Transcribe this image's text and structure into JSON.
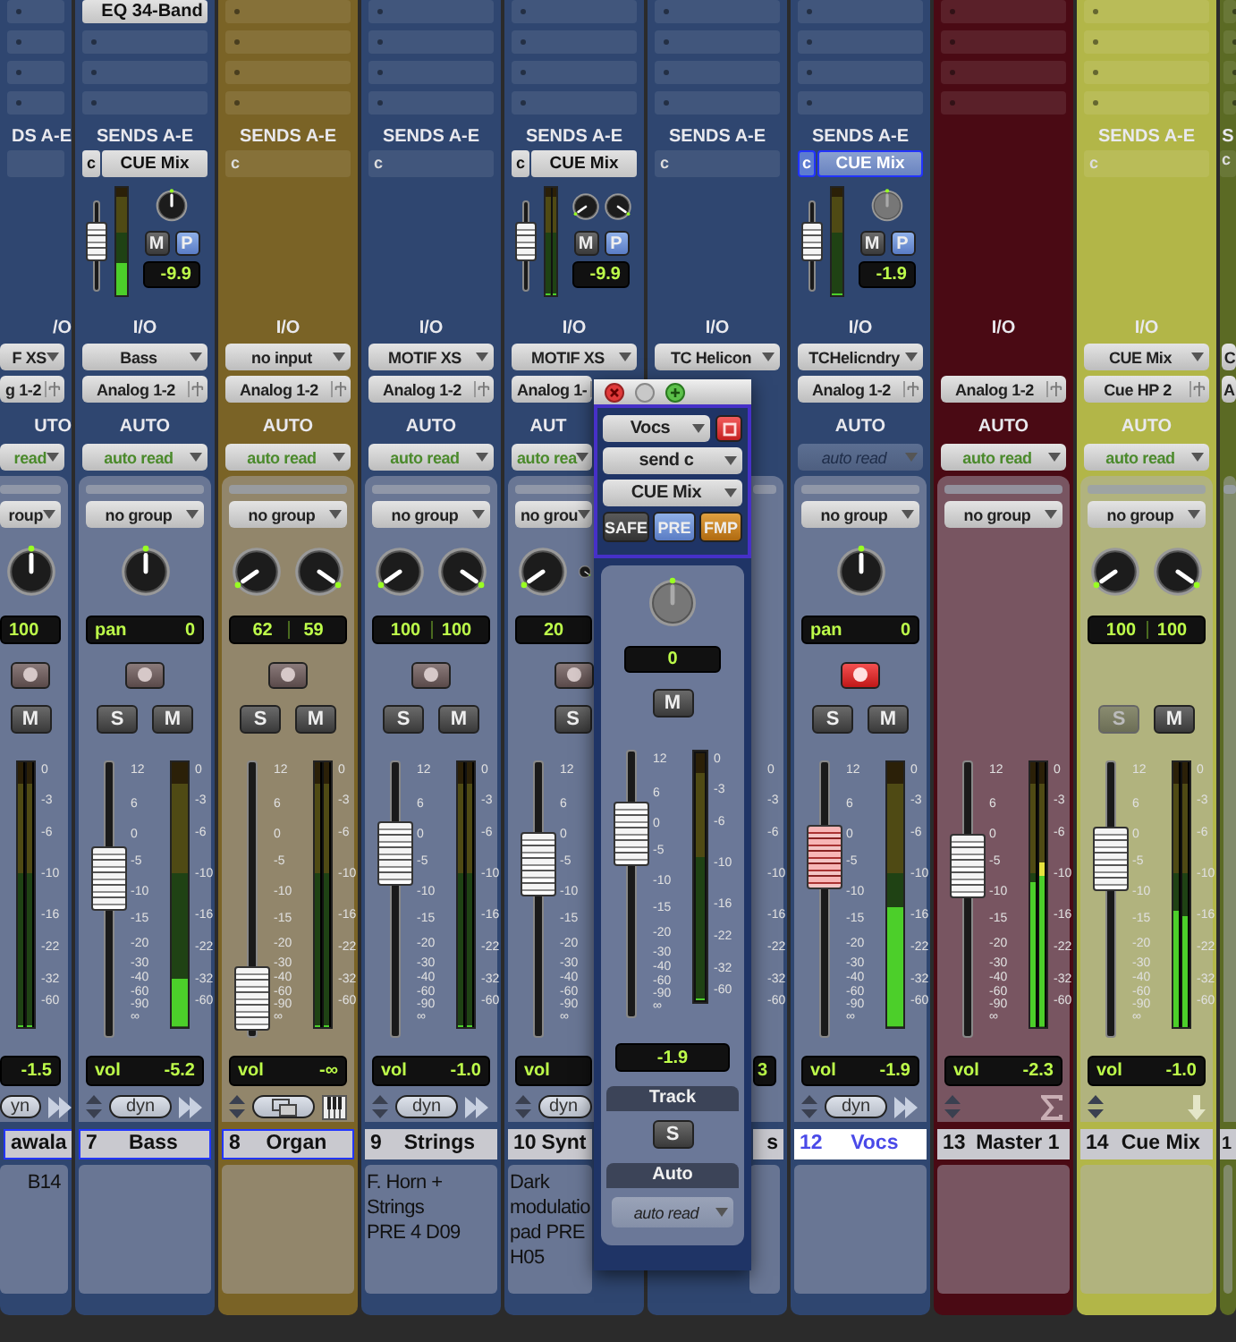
{
  "strips": [
    {
      "kind": "audio",
      "color": "#2f4670",
      "sends_header": "DS A-E",
      "io_label": "/O",
      "input": "F XS",
      "output": "g 1-2",
      "auto_label": "UTO",
      "automation": "read",
      "automation_disabled": false,
      "group": "roup",
      "stereo": false,
      "pan_readouts": [
        "100"
      ],
      "rec_armed": false,
      "mute": {
        "label": "M"
      },
      "meters": [
        {
          "level": 0
        },
        {
          "level": 0
        }
      ],
      "meter_scale": [
        "0",
        "-3",
        "-6",
        "-10",
        "-16",
        "-22",
        "-32",
        "-60"
      ],
      "vol_value": "-1.5",
      "dyn_label": "yn",
      "name": "awala",
      "selected": true,
      "highlighted": false,
      "comments": "B14"
    },
    {
      "kind": "audio",
      "color": "#2f4670",
      "inserts": [
        "EQ 34-Band"
      ],
      "sends_header": "SENDS A-E",
      "send": {
        "slot": "c",
        "name": "CUE Mix",
        "selected": false,
        "level": 0.6,
        "meters": [
          {
            "level": 0.3
          }
        ],
        "stereo": false,
        "mute_label": "M",
        "pre": {
          "label": "P",
          "on": true
        },
        "value": "-9.9"
      },
      "io_label": "I/O",
      "input": "Bass",
      "output": "Analog 1-2",
      "auto_label": "AUTO",
      "automation": "auto read",
      "automation_disabled": false,
      "group": "no group",
      "stereo": false,
      "pan_readouts": [
        "pan",
        "0"
      ],
      "rec_armed": false,
      "solo": {
        "label": "S",
        "disabled": false
      },
      "mute": {
        "label": "M"
      },
      "fader": {
        "level": 0.6
      },
      "fader_scale": [
        "12",
        "6",
        "0",
        "-5",
        "-10",
        "-15",
        "-20",
        "-30",
        "-40",
        "-60",
        "-90",
        "∞"
      ],
      "meters": [
        {
          "level": 0.18
        }
      ],
      "meter_scale": [
        "0",
        "-3",
        "-6",
        "-10",
        "-16",
        "-22",
        "-32",
        "-60"
      ],
      "vol_label": "vol",
      "vol_value": "-5.2",
      "dyn_label": "dyn",
      "number": "7",
      "name": "Bass",
      "selected": true,
      "highlighted": false
    },
    {
      "kind": "instrument",
      "color": "#7a6326",
      "sends_header": "SENDS A-E",
      "send": {
        "slot": "c"
      },
      "io_label": "I/O",
      "input": "no input",
      "output": "Analog 1-2",
      "auto_label": "AUTO",
      "automation": "auto read",
      "automation_disabled": false,
      "group": "no group",
      "stereo": true,
      "pan_readouts": [
        "62",
        "59"
      ],
      "rec_armed": false,
      "solo": {
        "label": "S",
        "disabled": false
      },
      "mute": {
        "label": "M"
      },
      "fader": {
        "level": 0.03
      },
      "fader_scale": [
        "12",
        "6",
        "0",
        "-5",
        "-10",
        "-15",
        "-20",
        "-30",
        "-40",
        "-60",
        "-90",
        "∞"
      ],
      "meters": [
        {
          "level": 0
        },
        {
          "level": 0
        }
      ],
      "meter_scale": [
        "0",
        "-3",
        "-6",
        "-10",
        "-16",
        "-22",
        "-32",
        "-60"
      ],
      "vol_label": "vol",
      "vol_value": "-∞",
      "number": "8",
      "name": "Organ",
      "selected": true,
      "highlighted": false
    },
    {
      "kind": "audio",
      "color": "#2f4670",
      "sends_header": "SENDS A-E",
      "send": {
        "slot": "c"
      },
      "io_label": "I/O",
      "input": "MOTIF XS",
      "output": "Analog 1-2",
      "auto_label": "AUTO",
      "automation": "auto read",
      "automation_disabled": false,
      "group": "no group",
      "stereo": true,
      "pan_readouts": [
        "100",
        "100"
      ],
      "rec_armed": false,
      "solo": {
        "label": "S",
        "disabled": false
      },
      "mute": {
        "label": "M"
      },
      "fader": {
        "level": 0.72
      },
      "fader_scale": [
        "12",
        "6",
        "0",
        "-5",
        "-10",
        "-15",
        "-20",
        "-30",
        "-40",
        "-60",
        "-90",
        "∞"
      ],
      "meters": [
        {
          "level": 0
        },
        {
          "level": 0
        }
      ],
      "meter_scale": [
        "0",
        "-3",
        "-6",
        "-10",
        "-16",
        "-22",
        "-32",
        "-60"
      ],
      "vol_label": "vol",
      "vol_value": "-1.0",
      "dyn_label": "dyn",
      "number": "9",
      "name": "Strings",
      "selected": false,
      "highlighted": false,
      "comments": "F. Horn +\nStrings\nPRE 4 D09"
    },
    {
      "kind": "audio",
      "color": "#2f4670",
      "sends_header": "SENDS A-E",
      "send": {
        "slot": "c",
        "name": "CUE Mix",
        "selected": false,
        "level": 0.6,
        "meters": [
          {
            "level": 0
          },
          {
            "level": 0
          }
        ],
        "stereo": true,
        "mute_label": "M",
        "pre": {
          "label": "P",
          "on": true
        },
        "value": "-9.9"
      },
      "io_label": "I/O",
      "input": "MOTIF XS",
      "output": "Analog 1-",
      "auto_label": "AUT",
      "automation": "auto rea",
      "automation_disabled": false,
      "group": "no grou",
      "stereo": true,
      "pan_readouts": [
        "20"
      ],
      "rec_armed": false,
      "solo": {
        "label": "S",
        "disabled": false
      },
      "fader": {
        "level": 0.67
      },
      "fader_scale": [
        "12",
        "6",
        "0",
        "-5",
        "-10",
        "-15",
        "-20",
        "-30",
        "-40",
        "-60",
        "-90",
        "∞"
      ],
      "vol_label": "vol",
      "dyn_label": "dyn",
      "number": "10",
      "name": "Synt",
      "selected": false,
      "highlighted": false,
      "comments": "Dark\nmodulatio\npad PRE\nH05"
    },
    {
      "kind": "audio",
      "color": "#2f4670",
      "sends_header": "SENDS A-E",
      "send": {
        "slot": "c"
      },
      "io_label": "I/O",
      "input": "TC Helicon",
      "meter_scale": [
        "0",
        "-3",
        "-6",
        "-10",
        "-16",
        "-22",
        "-32",
        "-60"
      ],
      "vol_value": "3",
      "name": "s",
      "selected": false,
      "highlighted": false
    },
    {
      "kind": "audio",
      "color": "#2f4670",
      "sends_header": "SENDS A-E",
      "send": {
        "slot": "c",
        "name": "CUE Mix",
        "selected": true,
        "level": 0.6,
        "meters": [
          {
            "level": 0
          }
        ],
        "stereo": false,
        "mute_label": "M",
        "pre": {
          "label": "P",
          "on": true
        },
        "value": "-1.9"
      },
      "io_label": "I/O",
      "input": "TCHelicndry",
      "output": "Analog 1-2",
      "auto_label": "AUTO",
      "automation": "auto read",
      "automation_disabled": true,
      "group": "no group",
      "stereo": false,
      "pan_readouts": [
        "pan",
        "0"
      ],
      "rec_armed": true,
      "solo": {
        "label": "S",
        "disabled": false
      },
      "mute": {
        "label": "M"
      },
      "fader": {
        "level": 0.7
      },
      "fader_scale": [
        "12",
        "6",
        "0",
        "-5",
        "-10",
        "-15",
        "-20",
        "-30",
        "-40",
        "-60",
        "-90",
        "∞"
      ],
      "meters": [
        {
          "level": 0.45
        }
      ],
      "meter_scale": [
        "0",
        "-3",
        "-6",
        "-10",
        "-16",
        "-22",
        "-32",
        "-60"
      ],
      "vol_label": "vol",
      "vol_value": "-1.9",
      "dyn_label": "dyn",
      "number": "12",
      "name": "Vocs",
      "selected": false,
      "highlighted": true
    },
    {
      "kind": "master",
      "color": "#4a0a14",
      "io_label": "I/O",
      "output": "Analog 1-2",
      "auto_label": "AUTO",
      "automation": "auto read",
      "automation_disabled": false,
      "group": "no group",
      "fader": {
        "level": 0.66
      },
      "fader_scale": [
        "12",
        "6",
        "0",
        "-5",
        "-10",
        "-15",
        "-20",
        "-30",
        "-40",
        "-60",
        "-90",
        "∞"
      ],
      "meters": [
        {
          "level": 0.55
        },
        {
          "level": 0.62
        }
      ],
      "meter_scale": [
        "0",
        "-3",
        "-6",
        "-10",
        "-16",
        "-22",
        "-32",
        "-60"
      ],
      "vol_label": "vol",
      "vol_value": "-2.3",
      "number": "13",
      "name": "Master 1",
      "selected": false,
      "highlighted": false
    },
    {
      "kind": "aux",
      "color": "#b2b648",
      "sends_header": "SENDS A-E",
      "send": {
        "slot": "c"
      },
      "io_label": "I/O",
      "input": "CUE Mix",
      "output": "Cue HP 2",
      "auto_label": "AUTO",
      "automation": "auto read",
      "automation_disabled": false,
      "group": "no group",
      "stereo": true,
      "pan_readouts": [
        "100",
        "100"
      ],
      "solo": {
        "label": "S",
        "disabled": true
      },
      "mute": {
        "label": "M"
      },
      "fader": {
        "level": 0.69
      },
      "fader_scale": [
        "12",
        "6",
        "0",
        "-5",
        "-10",
        "-15",
        "-20",
        "-30",
        "-40",
        "-60",
        "-90",
        "∞"
      ],
      "meters": [
        {
          "level": 0.44
        },
        {
          "level": 0.42
        }
      ],
      "meter_scale": [
        "0",
        "-3",
        "-6",
        "-10",
        "-16",
        "-22",
        "-32",
        "-60"
      ],
      "vol_label": "vol",
      "vol_value": "-1.0",
      "number": "14",
      "name": "Cue Mix",
      "selected": false,
      "highlighted": false
    },
    {
      "kind": "aux",
      "color": "#5b6a24",
      "sends_header": "S",
      "send": {
        "slot": "c"
      },
      "input": "C",
      "output": "A",
      "number": "1",
      "selected": false,
      "highlighted": false
    }
  ],
  "send_window": {
    "track": "Vocs",
    "send": "send c",
    "output": "CUE Mix",
    "safe": {
      "label": "SAFE",
      "on": false
    },
    "pre": {
      "label": "PRE",
      "on": true
    },
    "fmp": {
      "label": "FMP",
      "on": true
    },
    "pan_readout": "0",
    "mute": {
      "label": "M"
    },
    "fader": {
      "level": 0.75
    },
    "fader_scale": [
      "12",
      "6",
      "0",
      "-5",
      "-10",
      "-15",
      "-20",
      "-30",
      "-40",
      "-60",
      "-90",
      "∞"
    ],
    "meters": [
      {
        "level": 0
      }
    ],
    "meter_scale": [
      "0",
      "-3",
      "-6",
      "-10",
      "-16",
      "-22",
      "-32",
      "-60"
    ],
    "value": "-1.9",
    "track_label": "Track",
    "solo": {
      "label": "S"
    },
    "auto_label": "Auto",
    "automation": "auto read"
  }
}
